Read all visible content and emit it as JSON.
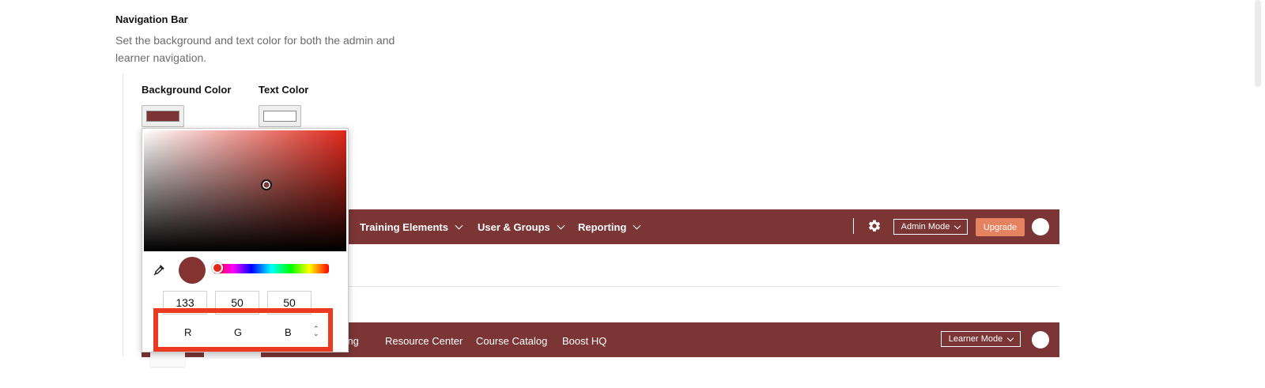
{
  "section": {
    "title": "Navigation Bar",
    "description": "Set the background and text color for both the admin and learner navigation."
  },
  "background_color": {
    "label": "Background Color",
    "value": "#7b3535"
  },
  "text_color": {
    "label": "Text Color",
    "value": "#ffffff"
  },
  "admin_nav": {
    "items": [
      {
        "label": "Training Elements"
      },
      {
        "label": "User & Groups"
      },
      {
        "label": "Reporting"
      }
    ],
    "mode_button": "Admin Mode",
    "upgrade_button": "Upgrade"
  },
  "learner_nav": {
    "partial_item": "rning",
    "items": [
      "Resource Center",
      "Course Catalog",
      "Boost HQ"
    ],
    "mode_button": "Learner Mode"
  },
  "color_picker": {
    "selected_color": "#853232",
    "hue_color": "#e0271a",
    "rgb": {
      "r": "133",
      "g": "50",
      "b": "50"
    },
    "labels": {
      "r": "R",
      "g": "G",
      "b": "B"
    },
    "toggle_icon": "up-down-chevron-icon",
    "eyedropper_icon": "eyedropper-icon"
  },
  "highlight_color": "#ea3b22"
}
